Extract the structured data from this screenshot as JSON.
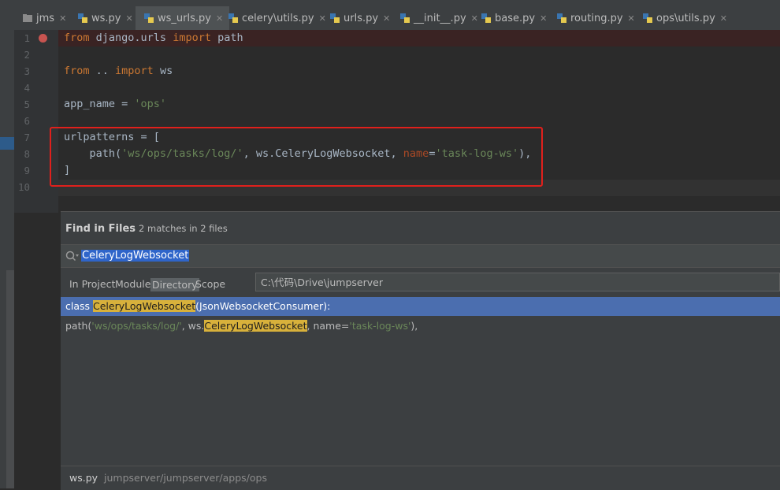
{
  "tabs": [
    {
      "label": "jms"
    },
    {
      "label": "ws.py"
    },
    {
      "label": "ws_urls.py",
      "active": true
    },
    {
      "label": "celery\\utils.py"
    },
    {
      "label": "urls.py"
    },
    {
      "label": "__init__.py"
    },
    {
      "label": "base.py"
    },
    {
      "label": "routing.py"
    },
    {
      "label": "ops\\utils.py"
    }
  ],
  "line_numbers": [
    "1",
    "2",
    "3",
    "4",
    "5",
    "6",
    "7",
    "8",
    "9",
    "10"
  ],
  "code": {
    "l1": {
      "k1": "from",
      "t1": " django.urls ",
      "k2": "import",
      "t2": " path"
    },
    "l3": {
      "k1": "from",
      "t1": " .. ",
      "k2": "import",
      "t2": " ws"
    },
    "l5": {
      "t1": "app_name = ",
      "s1": "'ops'"
    },
    "l7": {
      "t1": "urlpatterns = ["
    },
    "l8": {
      "t1": "    path(",
      "s1": "'ws/ops/tasks/log/'",
      "t2": ", ws.CeleryLogWebsocket, ",
      "p1": "name",
      "t3": "=",
      "s2": "'task-log-ws'",
      "t4": "),"
    },
    "l9": {
      "t1": "]"
    }
  },
  "find": {
    "title": "Find in Files",
    "count": "2 matches in 2 files",
    "query": "CeleryLogWebsocket",
    "scopes": {
      "project": "In Project",
      "module": "Module",
      "directory": "Directory",
      "scope": "Scope"
    },
    "path": "C:\\代码\\Drive\\jumpserver",
    "results": [
      {
        "pre": "class ",
        "match": "CeleryLogWebsocket",
        "post": "(JsonWebsocketConsumer):"
      },
      {
        "pre": "path(",
        "str1": "'ws/ops/tasks/log/'",
        "mid": ", ws.",
        "match": "CeleryLogWebsocket",
        "post": ", name=",
        "str2": "'task-log-ws'",
        "end": "),"
      }
    ],
    "preview_file": "ws.py",
    "preview_path": "jumpserver/jumpserver/apps/ops"
  },
  "colors": {
    "keyword": "#cc7832",
    "string": "#6a8759",
    "param": "#aa4926",
    "selection": "#4b6eaf",
    "match_highlight": "#d8b13b",
    "breakpoint": "#c75450"
  }
}
